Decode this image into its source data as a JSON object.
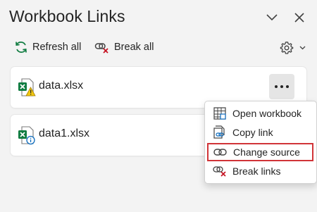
{
  "header": {
    "title": "Workbook Links",
    "collapse_icon": "chevron-down-icon",
    "close_icon": "close-icon"
  },
  "toolbar": {
    "refresh_label": "Refresh all",
    "break_label": "Break all",
    "settings_icon": "gear-icon"
  },
  "links": [
    {
      "name": "data.xlsx",
      "status_icon": "warning-icon"
    },
    {
      "name": "data1.xlsx",
      "status_icon": "info-icon"
    }
  ],
  "context_menu": {
    "items": [
      {
        "label": "Open workbook",
        "icon": "workbook-table-icon"
      },
      {
        "label": "Copy link",
        "icon": "copy-link-icon"
      },
      {
        "label": "Change source",
        "icon": "link-icon",
        "highlighted": true
      },
      {
        "label": "Break links",
        "icon": "break-link-icon"
      }
    ]
  },
  "colors": {
    "excel_green": "#107c41",
    "warning_yellow": "#f2c811",
    "info_blue": "#0f6cbd",
    "highlight_red": "#d13438",
    "break_red": "#c50f1f"
  }
}
